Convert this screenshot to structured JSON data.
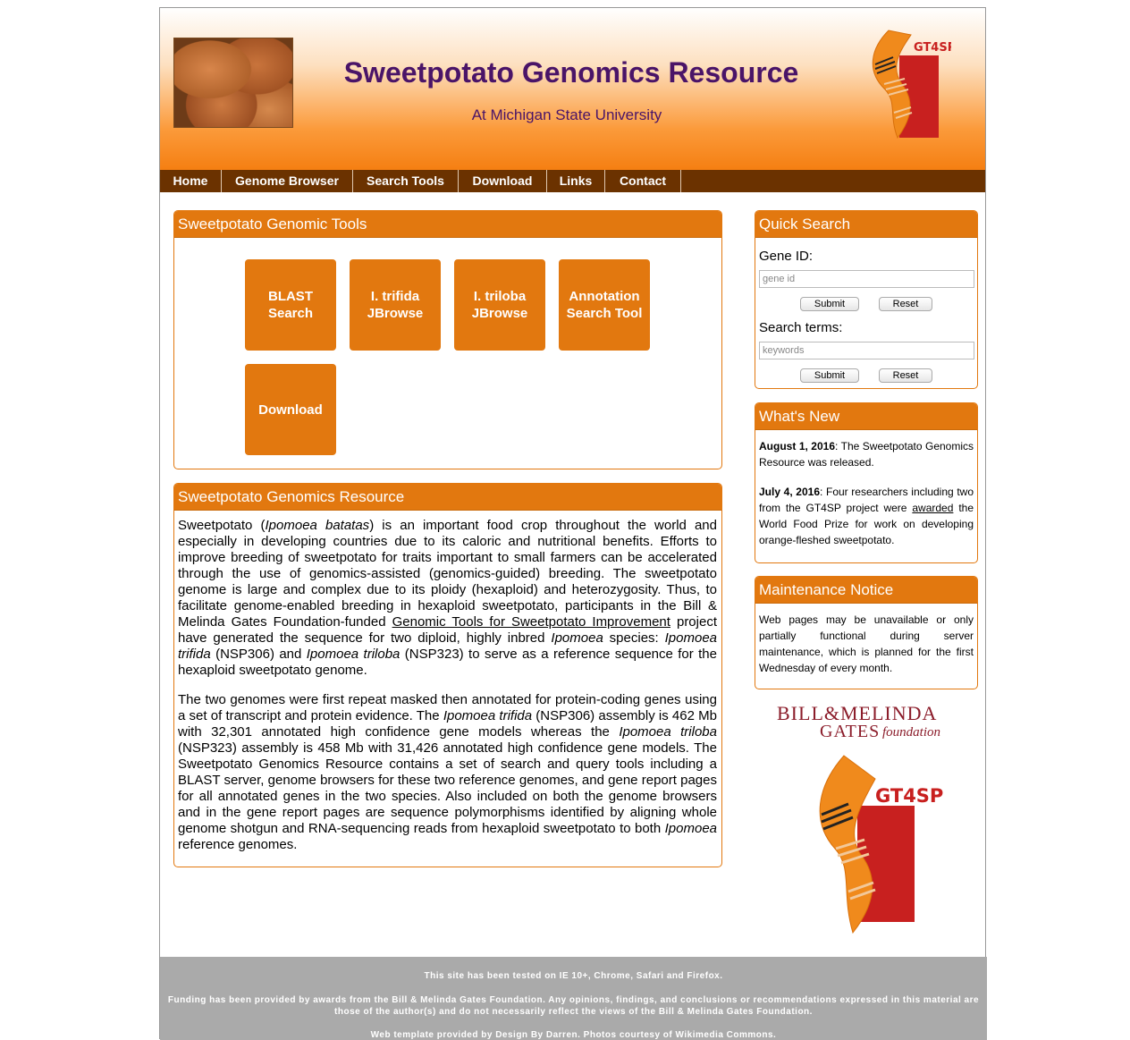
{
  "header": {
    "title": "Sweetpotato Genomics Resource",
    "subtitle": "At Michigan State University",
    "logo_text": "GT4SP"
  },
  "nav": {
    "items": [
      "Home",
      "Genome Browser",
      "Search Tools",
      "Download",
      "Links",
      "Contact"
    ]
  },
  "tools_panel": {
    "title": "Sweetpotato Genomic Tools",
    "buttons": [
      {
        "line1": "BLAST",
        "line2": "Search"
      },
      {
        "line1": "I. trifida",
        "line2": "JBrowse"
      },
      {
        "line1": "I. triloba",
        "line2": "JBrowse"
      },
      {
        "line1": "Annotation",
        "line2": "Search Tool"
      },
      {
        "line1": "Download",
        "line2": ""
      }
    ]
  },
  "resource_panel": {
    "title": "Sweetpotato Genomics Resource",
    "p1": {
      "a": "Sweetpotato (",
      "b": "Ipomoea batatas",
      "c": ") is an important food crop throughout the world and especially in developing countries due to its caloric and nutritional benefits. Efforts to improve breeding of sweetpotato for traits important to small farmers can be accelerated through the use of genomics-assisted (genomics-guided) breeding. The sweetpotato genome is large and complex due to its ploidy (hexaploid) and heterozygosity. Thus, to facilitate genome-enabled breeding in hexaploid sweetpotato, participants in the Bill & Melinda Gates Foundation-funded ",
      "link": "Genomic Tools for Sweetpotato Improvement",
      "d": " project have generated the sequence for two diploid, highly inbred ",
      "e": "Ipomoea",
      "f": " species: ",
      "g": "Ipomoea trifida",
      "h": " (NSP306) and ",
      "i": "Ipomoea triloba",
      "j": " (NSP323) to serve as a reference sequence for the hexaploid sweetpotato genome."
    },
    "p2": {
      "a": "The two genomes were first repeat masked then annotated for protein-coding genes using a set of transcript and protein evidence. The ",
      "b": "Ipomoea trifida",
      "c": " (NSP306) assembly is 462 Mb with 32,301 annotated high confidence gene models whereas the ",
      "d": "Ipomoea triloba",
      "e": " (NSP323) assembly is 458 Mb with 31,426 annotated high confidence gene models. The Sweetpotato Genomics Resource contains a set of search and query tools including a BLAST server, genome browsers for these two reference genomes, and gene report pages for all annotated genes in the two species. Also included on both the genome browsers and in the gene report pages are sequence polymorphisms identified by aligning whole genome shotgun and RNA-sequencing reads from hexaploid sweetpotato to both ",
      "f": "Ipomoea",
      "g": " reference genomes."
    }
  },
  "quick_search": {
    "title": "Quick Search",
    "gene_label": "Gene ID:",
    "gene_placeholder": "gene id",
    "terms_label": "Search terms:",
    "terms_placeholder": "keywords",
    "submit": "Submit",
    "reset": "Reset"
  },
  "whats_new": {
    "title": "What's New",
    "item1_date": "August 1, 2016",
    "item1_text": ": The Sweetpotato Genomics Resource was released.",
    "item2_date": "July 4, 2016",
    "item2_text_a": ": Four researchers including two from the GT4SP project were ",
    "item2_link": "awarded",
    "item2_text_b": " the World Food Prize for work on developing orange-fleshed sweetpotato."
  },
  "maintenance": {
    "title": "Maintenance Notice",
    "text": "Web pages may be unavailable or only partially functional during server maintenance, which is planned for the first Wednesday of every month."
  },
  "gates_logo": {
    "line1": "BILL&MELINDA",
    "line2": "GATES",
    "line3": "foundation"
  },
  "gt4sp_logo": {
    "text": "GT4SP"
  },
  "footer": {
    "line1": "This site has been tested on IE 10+, Chrome, Safari and Firefox.",
    "line2": "Funding has been provided by awards from the Bill & Melinda Gates Foundation. Any opinions, findings, and conclusions or recommendations expressed in this material are those of the author(s) and do not necessarily reflect the views of the Bill & Melinda Gates Foundation.",
    "line3": "Web template provided by Design By Darren. Photos courtesy of Wikimedia Commons."
  },
  "colors": {
    "accent": "#e2780f",
    "nav_bg": "#6b3200",
    "title": "#4a1468",
    "footer_bg": "#aaaaaa"
  }
}
